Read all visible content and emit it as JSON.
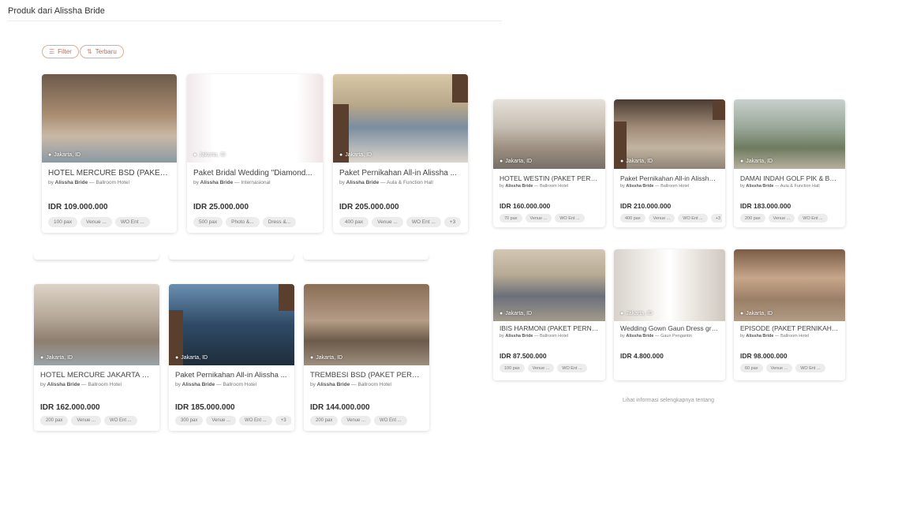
{
  "page": {
    "title": "Produk dari Alissha Bride"
  },
  "controls": {
    "filter_label": "Filter",
    "sort_label": "Terbaru"
  },
  "products": [
    {
      "name": "HOTEL MERCURE BSD (PAKET ...",
      "vendor": "Alissha Bride",
      "category": "Ballroom Hotel",
      "price": "IDR 109.000.000",
      "location": "Jakarta, ID",
      "tags": [
        "100 pax",
        "Venue ...",
        "WO Ent ..."
      ]
    },
    {
      "name": "Paket Bridal Wedding \"Diamond...",
      "vendor": "Alissha Bride",
      "category": "Internasional",
      "price": "IDR 25.000.000",
      "location": "Jakarta, ID",
      "tags": [
        "500 pax",
        "Photo &...",
        "Dress &..."
      ]
    },
    {
      "name": "Paket Pernikahan All-in Alissha ...",
      "vendor": "Alissha Bride",
      "category": "Aula & Function Hall",
      "price": "IDR 205.000.000",
      "location": "Jakarta, ID",
      "tags": [
        "400 pax",
        "Venue ...",
        "WO Ent ...",
        "+3"
      ]
    },
    {
      "name": "HOTEL MERCURE JAKARTA BA...",
      "vendor": "Alissha Bride",
      "category": "Ballroom Hotel",
      "price": "IDR 162.000.000",
      "location": "Jakarta, ID",
      "tags": [
        "200 pax",
        "Venue ...",
        "WO Ent ..."
      ]
    },
    {
      "name": "Paket Pernikahan All-in Alissha ...",
      "vendor": "Alissha Bride",
      "category": "Ballroom Hotel",
      "price": "IDR 185.000.000",
      "location": "Jakarta, ID",
      "tags": [
        "300 pax",
        "Venue ...",
        "WO Ent ...",
        "+3"
      ]
    },
    {
      "name": "TREMBESI BSD (PAKET PERNI...",
      "vendor": "Alissha Bride",
      "category": "Ballroom Hotel",
      "price": "IDR 144.000.000",
      "location": "Jakarta, ID",
      "tags": [
        "200 pax",
        "Venue ...",
        "WO Ent ..."
      ]
    },
    {
      "name": "HOTEL WESTIN (PAKET PERNI...",
      "vendor": "Alissha Bride",
      "category": "Ballroom Hotel",
      "price": "IDR 160.000.000",
      "location": "Jakarta, ID",
      "tags": [
        "70 pax",
        "Venue ...",
        "WO Ent ..."
      ]
    },
    {
      "name": "Paket Pernikahan All-in Alissha ...",
      "vendor": "Alissha Bride",
      "category": "Ballroom Hotel",
      "price": "IDR 210.000.000",
      "location": "Jakarta, ID",
      "tags": [
        "400 pax",
        "Venue ...",
        "WO Ent ...",
        "+3"
      ]
    },
    {
      "name": "DAMAI INDAH GOLF PIK & BSD...",
      "vendor": "Alissha Bride",
      "category": "Aula & Function Hall",
      "price": "IDR 183.000.000",
      "location": "Jakarta, ID",
      "tags": [
        "200 pax",
        "Venue ...",
        "WO Ent ..."
      ]
    },
    {
      "name": "IBIS HARMONI (PAKET PERNIK...",
      "vendor": "Alissha Bride",
      "category": "Ballroom Hotel",
      "price": "IDR 87.500.000",
      "location": "Jakarta, ID",
      "tags": [
        "100 pax",
        "Venue ...",
        "WO Ent ..."
      ]
    },
    {
      "name": "Wedding Gown Gaun Dress gra...",
      "vendor": "Alissha Bride",
      "category": "Gaun Pengantin",
      "price": "IDR 4.800.000",
      "location": "Jakarta, ID",
      "tags": []
    },
    {
      "name": "EPISODE (PAKET PERNIKAHAN ...",
      "vendor": "Alissha Bride",
      "category": "Ballroom Hotel",
      "price": "IDR 98.000.000",
      "location": "Jakarta, ID",
      "tags": [
        "60 pax",
        "Venue ...",
        "WO Ent ..."
      ]
    }
  ],
  "footer": {
    "more_info": "Lihat informasi selengkapnya tentang"
  },
  "icons": {
    "filter": "sliders-icon",
    "sort": "sort-icon",
    "location": "location-pin-icon"
  },
  "colors": {
    "accent": "#e5a99a",
    "tag_bg": "#ececec"
  }
}
